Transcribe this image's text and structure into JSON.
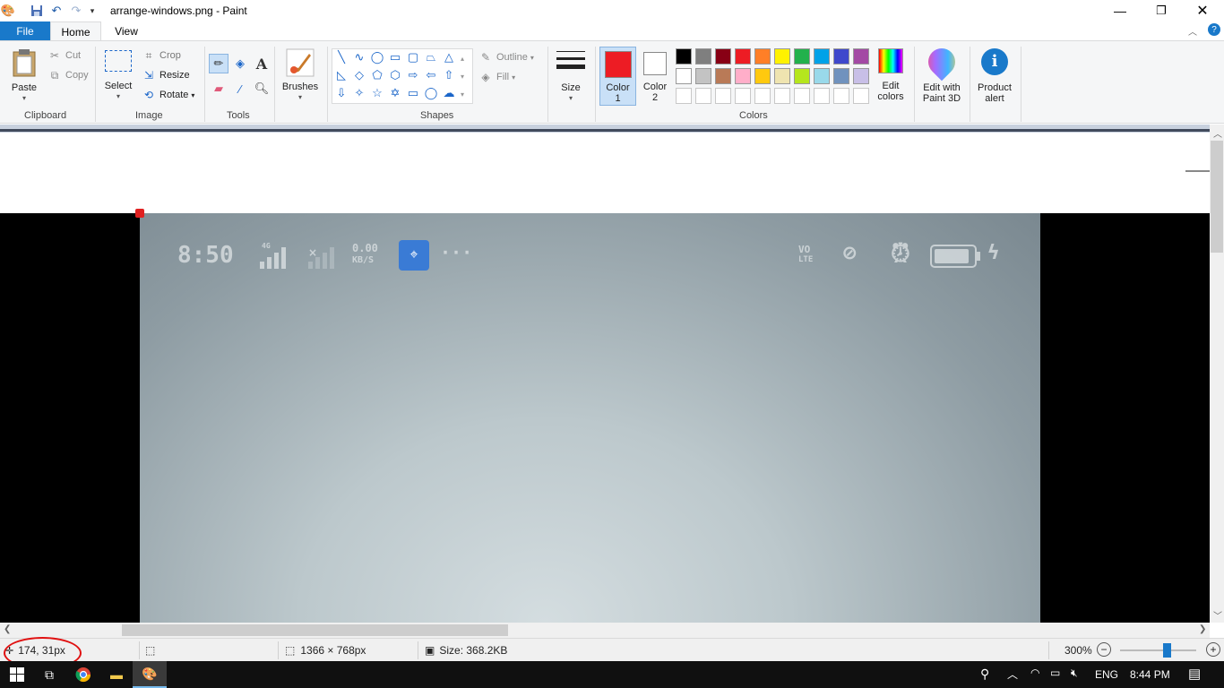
{
  "window": {
    "title": "arrange-windows.png - Paint",
    "minimize_icon": "minimize-icon",
    "restore_icon": "restore-icon",
    "close_icon": "close-icon"
  },
  "quick_access": {
    "save_icon": "save-icon",
    "undo_icon": "undo-icon",
    "redo_icon": "redo-icon",
    "customize_icon": "chevron-down-icon"
  },
  "tabs": {
    "file": "File",
    "home": "Home",
    "view": "View"
  },
  "ribbon": {
    "clipboard": {
      "paste": "Paste",
      "cut": "Cut",
      "copy": "Copy",
      "label": "Clipboard"
    },
    "image": {
      "select": "Select",
      "crop": "Crop",
      "resize": "Resize",
      "rotate": "Rotate",
      "label": "Image"
    },
    "tools": {
      "label": "Tools",
      "text_glyph": "A"
    },
    "brushes": {
      "label": "Brushes"
    },
    "shapes": {
      "outline": "Outline",
      "fill": "Fill",
      "label": "Shapes"
    },
    "size": {
      "label": "Size"
    },
    "colors": {
      "color1_line1": "Color",
      "color1_line2": "1",
      "color2_line1": "Color",
      "color2_line2": "2",
      "color1_value": "#ed1c24",
      "color2_value": "#ffffff",
      "edit_line1": "Edit",
      "edit_line2": "colors",
      "label": "Colors",
      "palette_row1": [
        "#000000",
        "#7f7f7f",
        "#880015",
        "#ed1c24",
        "#ff7f27",
        "#fff200",
        "#22b14c",
        "#00a2e8",
        "#3f48cc",
        "#a349a4"
      ],
      "palette_row2": [
        "#ffffff",
        "#c3c3c3",
        "#b97a57",
        "#ffaec9",
        "#ffc90e",
        "#efe4b0",
        "#b5e61d",
        "#99d9ea",
        "#7092be",
        "#c8bfe7"
      ]
    },
    "paint3d": {
      "line1": "Edit with",
      "line2": "Paint 3D"
    },
    "product_alert": {
      "line1": "Product",
      "line2": "alert"
    }
  },
  "phone_status": {
    "time": "8:50",
    "net_type": "4G",
    "speed_value": "0.00",
    "speed_unit": "KB/S",
    "dots": "···",
    "volte": "VO",
    "lte": "LTE"
  },
  "statusbar": {
    "cursor_pos": "174, 31px",
    "image_size": "1366 × 768px",
    "file_size": "Size: 368.2KB",
    "zoom": "300%"
  },
  "taskbar": {
    "lang": "ENG",
    "time": "8:44 PM"
  }
}
